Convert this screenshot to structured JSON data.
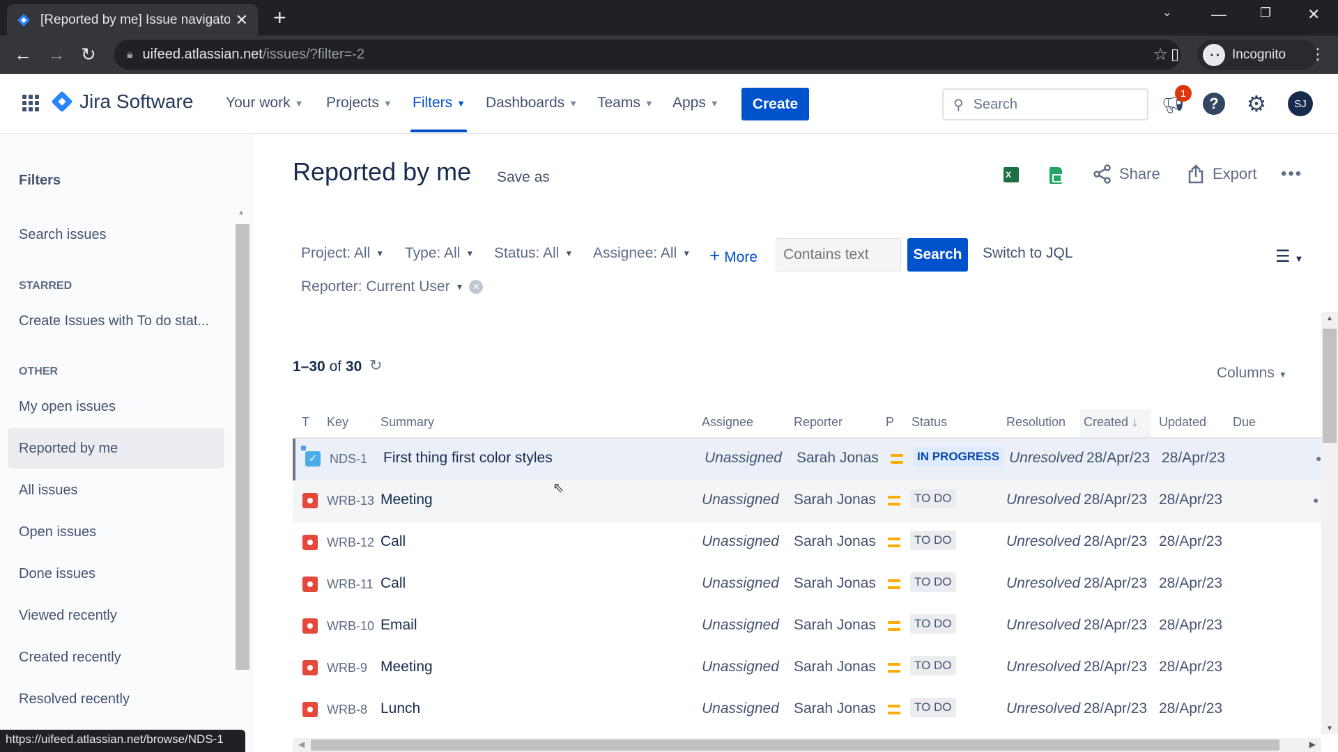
{
  "browser": {
    "tab_title": "[Reported by me] Issue navigator",
    "url_host": "uifeed.atlassian.net",
    "url_path": "/issues/?filter=-2",
    "profile_label": "Incognito",
    "status_url": "https://uifeed.atlassian.net/browse/NDS-1"
  },
  "topnav": {
    "product": "Jira Software",
    "items": [
      {
        "label": "Your work",
        "active": false
      },
      {
        "label": "Projects",
        "active": false
      },
      {
        "label": "Filters",
        "active": true
      },
      {
        "label": "Dashboards",
        "active": false
      },
      {
        "label": "Teams",
        "active": false
      },
      {
        "label": "Apps",
        "active": false
      }
    ],
    "create_label": "Create",
    "search_placeholder": "Search",
    "notification_count": "1",
    "avatar_initials": "SJ"
  },
  "sidebar": {
    "title": "Filters",
    "search_issues": "Search issues",
    "starred_heading": "STARRED",
    "starred_items": [
      "Create Issues with To do stat..."
    ],
    "other_heading": "OTHER",
    "other_items": [
      {
        "label": "My open issues",
        "selected": false
      },
      {
        "label": "Reported by me",
        "selected": true
      },
      {
        "label": "All issues",
        "selected": false
      },
      {
        "label": "Open issues",
        "selected": false
      },
      {
        "label": "Done issues",
        "selected": false
      },
      {
        "label": "Viewed recently",
        "selected": false
      },
      {
        "label": "Created recently",
        "selected": false
      },
      {
        "label": "Resolved recently",
        "selected": false
      }
    ]
  },
  "page": {
    "title": "Reported by me",
    "save_as": "Save as",
    "share": "Share",
    "export": "Export",
    "filters": {
      "project": "Project: All",
      "type": "Type: All",
      "status": "Status: All",
      "assignee": "Assignee: All",
      "more": "More",
      "contains_placeholder": "Contains text",
      "search_button": "Search",
      "switch_jql": "Switch to JQL",
      "reporter": "Reporter: Current User"
    },
    "count": {
      "range": "1–30",
      "of": "of",
      "total": "30"
    },
    "columns_label": "Columns"
  },
  "table": {
    "headers": {
      "type": "T",
      "key": "Key",
      "summary": "Summary",
      "assignee": "Assignee",
      "reporter": "Reporter",
      "priority": "P",
      "status": "Status",
      "resolution": "Resolution",
      "created": "Created",
      "updated": "Updated",
      "due": "Due"
    },
    "sorted_by": "Created",
    "sort_direction": "descending",
    "rows": [
      {
        "type": "task",
        "key": "NDS-1",
        "summary": "First thing first color styles",
        "assignee": "Unassigned",
        "reporter": "Sarah Jonas",
        "priority": "medium",
        "status": "IN PROGRESS",
        "resolution": "Unresolved",
        "created": "28/Apr/23",
        "updated": "28/Apr/23"
      },
      {
        "type": "bug",
        "key": "WRB-13",
        "summary": "Meeting",
        "assignee": "Unassigned",
        "reporter": "Sarah Jonas",
        "priority": "medium",
        "status": "TO DO",
        "resolution": "Unresolved",
        "created": "28/Apr/23",
        "updated": "28/Apr/23"
      },
      {
        "type": "bug",
        "key": "WRB-12",
        "summary": "Call",
        "assignee": "Unassigned",
        "reporter": "Sarah Jonas",
        "priority": "medium",
        "status": "TO DO",
        "resolution": "Unresolved",
        "created": "28/Apr/23",
        "updated": "28/Apr/23"
      },
      {
        "type": "bug",
        "key": "WRB-11",
        "summary": "Call",
        "assignee": "Unassigned",
        "reporter": "Sarah Jonas",
        "priority": "medium",
        "status": "TO DO",
        "resolution": "Unresolved",
        "created": "28/Apr/23",
        "updated": "28/Apr/23"
      },
      {
        "type": "bug",
        "key": "WRB-10",
        "summary": "Email",
        "assignee": "Unassigned",
        "reporter": "Sarah Jonas",
        "priority": "medium",
        "status": "TO DO",
        "resolution": "Unresolved",
        "created": "28/Apr/23",
        "updated": "28/Apr/23"
      },
      {
        "type": "bug",
        "key": "WRB-9",
        "summary": "Meeting",
        "assignee": "Unassigned",
        "reporter": "Sarah Jonas",
        "priority": "medium",
        "status": "TO DO",
        "resolution": "Unresolved",
        "created": "28/Apr/23",
        "updated": "28/Apr/23"
      },
      {
        "type": "bug",
        "key": "WRB-8",
        "summary": "Lunch",
        "assignee": "Unassigned",
        "reporter": "Sarah Jonas",
        "priority": "medium",
        "status": "TO DO",
        "resolution": "Unresolved",
        "created": "28/Apr/23",
        "updated": "28/Apr/23"
      }
    ]
  },
  "colors": {
    "brand": "#0052cc",
    "in_progress": "#0747a6",
    "priority_medium": "#ffab00",
    "bug": "#e5493a",
    "task": "#4bade8"
  }
}
